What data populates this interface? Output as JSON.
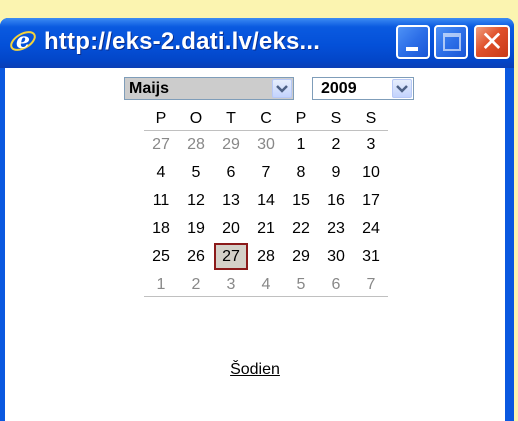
{
  "window": {
    "title": "http://eks-2.dati.lv/eks...",
    "min_label": "",
    "max_label": "",
    "close_label": "✕"
  },
  "picker": {
    "month_value": "Maijs",
    "year_value": "2009",
    "today_label": "Šodien",
    "weekday_headers": [
      "P",
      "O",
      "T",
      "C",
      "P",
      "S",
      "S"
    ],
    "weeks": [
      [
        {
          "d": "27",
          "other": true
        },
        {
          "d": "28",
          "other": true
        },
        {
          "d": "29",
          "other": true
        },
        {
          "d": "30",
          "other": true
        },
        {
          "d": "1",
          "other": false
        },
        {
          "d": "2",
          "other": false
        },
        {
          "d": "3",
          "other": false
        }
      ],
      [
        {
          "d": "4",
          "other": false
        },
        {
          "d": "5",
          "other": false
        },
        {
          "d": "6",
          "other": false
        },
        {
          "d": "7",
          "other": false
        },
        {
          "d": "8",
          "other": false
        },
        {
          "d": "9",
          "other": false
        },
        {
          "d": "10",
          "other": false
        }
      ],
      [
        {
          "d": "11",
          "other": false
        },
        {
          "d": "12",
          "other": false
        },
        {
          "d": "13",
          "other": false
        },
        {
          "d": "14",
          "other": false
        },
        {
          "d": "15",
          "other": false
        },
        {
          "d": "16",
          "other": false
        },
        {
          "d": "17",
          "other": false
        }
      ],
      [
        {
          "d": "18",
          "other": false
        },
        {
          "d": "19",
          "other": false
        },
        {
          "d": "20",
          "other": false
        },
        {
          "d": "21",
          "other": false
        },
        {
          "d": "22",
          "other": false
        },
        {
          "d": "23",
          "other": false
        },
        {
          "d": "24",
          "other": false
        }
      ],
      [
        {
          "d": "25",
          "other": false
        },
        {
          "d": "26",
          "other": false
        },
        {
          "d": "27",
          "other": false,
          "today": true
        },
        {
          "d": "28",
          "other": false
        },
        {
          "d": "29",
          "other": false
        },
        {
          "d": "30",
          "other": false
        },
        {
          "d": "31",
          "other": false
        }
      ],
      [
        {
          "d": "1",
          "other": true
        },
        {
          "d": "2",
          "other": true
        },
        {
          "d": "3",
          "other": true
        },
        {
          "d": "4",
          "other": true
        },
        {
          "d": "5",
          "other": true
        },
        {
          "d": "6",
          "other": true
        },
        {
          "d": "7",
          "other": true
        }
      ]
    ]
  },
  "icons": [
    "ie-logo-icon",
    "minimize-icon",
    "maximize-icon",
    "close-icon",
    "chevron-down-icon"
  ]
}
